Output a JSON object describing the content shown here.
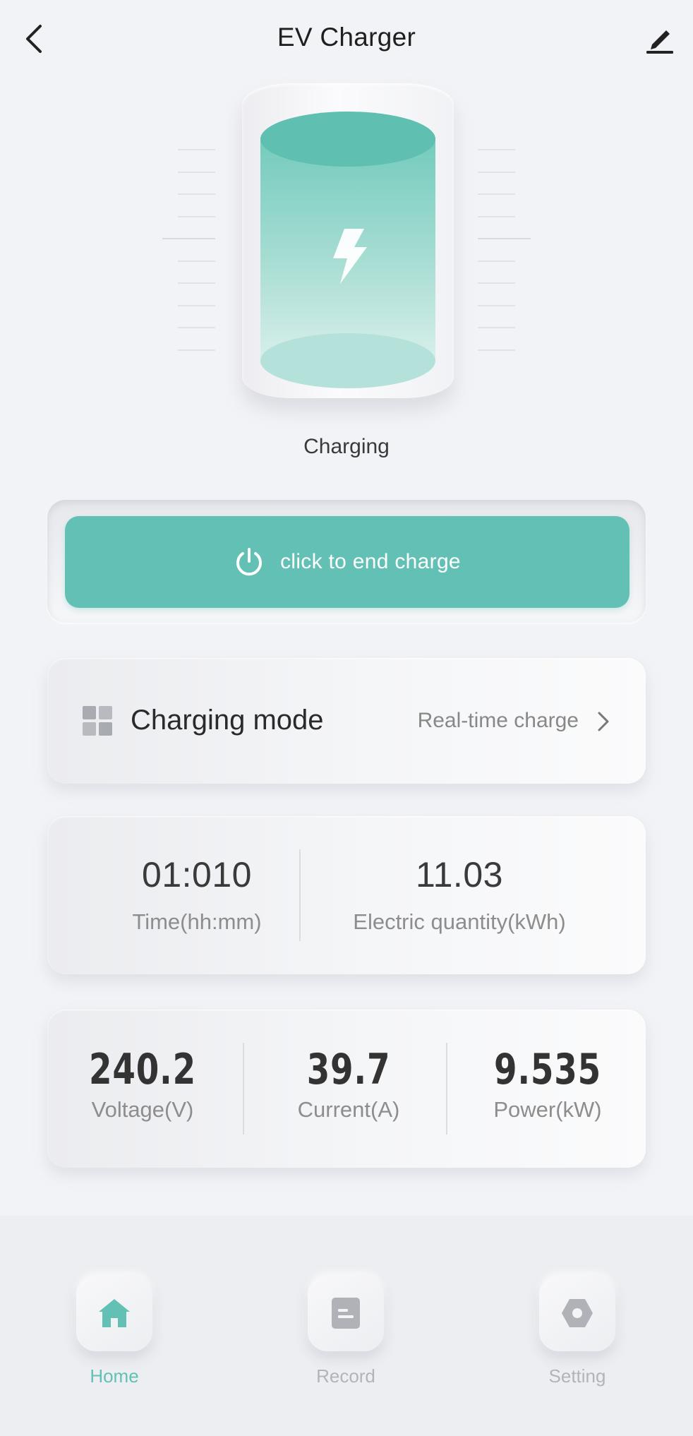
{
  "header": {
    "title": "EV Charger",
    "back_icon": "chevron-left-icon",
    "edit_icon": "edit-pencil-icon"
  },
  "charger": {
    "status": "Charging",
    "icon": "lightning-bolt-icon"
  },
  "end_button": {
    "label": "click to end charge",
    "icon": "power-icon",
    "color": "#62c1b4"
  },
  "charging_mode": {
    "label": "Charging mode",
    "value": "Real-time charge",
    "icon": "grid-icon"
  },
  "session": {
    "time": {
      "value": "01:010",
      "label": "Time(hh:mm)"
    },
    "energy": {
      "value": "11.03",
      "label": "Electric quantity(kWh)"
    }
  },
  "meters": [
    {
      "value": "240.2",
      "label": "Voltage(V)"
    },
    {
      "value": "39.7",
      "label": "Current(A)"
    },
    {
      "value": "9.535",
      "label": "Power(kW)"
    }
  ],
  "nav": {
    "items": [
      {
        "label": "Home",
        "icon": "home-icon",
        "active": true
      },
      {
        "label": "Record",
        "icon": "document-icon",
        "active": false
      },
      {
        "label": "Setting",
        "icon": "hexagon-settings-icon",
        "active": false
      }
    ]
  },
  "colors": {
    "accent": "#62c1b4",
    "background": "#f2f3f6",
    "muted_text": "#8d8d8d"
  }
}
